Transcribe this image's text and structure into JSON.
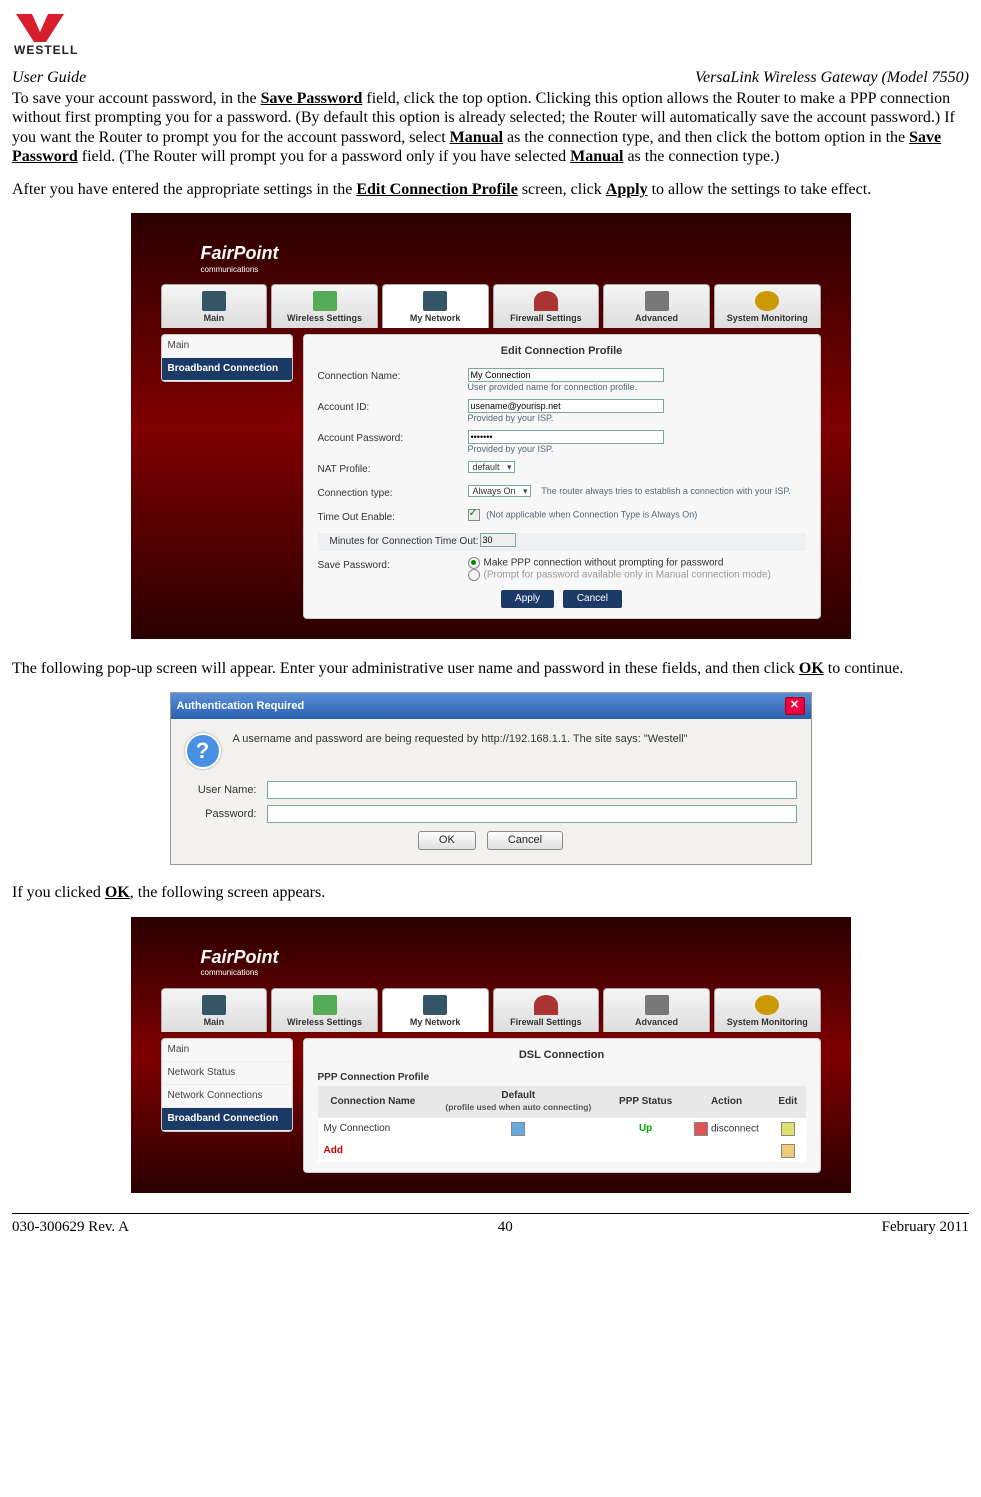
{
  "logo_text_main": "WESTELL",
  "header": {
    "left": "User Guide",
    "right": "VersaLink Wireless Gateway (Model 7550)"
  },
  "para1": {
    "t1": "To save your account password, in the ",
    "b1": "Save Password",
    "t2": " field, click the top option. Clicking this option allows the Router to make a PPP connection without first prompting you for a password. (By default this option is already selected; the Router will automatically save the account password.) If you want the Router to prompt you for the account password, select ",
    "b2": "Manual",
    "t3": " as the connection type, and then click the bottom option in the ",
    "b3": "Save Password",
    "t4": " field. (The Router will prompt you for a password only if you have selected ",
    "b4": "Manual",
    "t5": " as the connection type.)"
  },
  "para2": {
    "t1": "After you have entered the appropriate settings in the ",
    "b1": "Edit Connection Profile",
    "t2": " screen, click ",
    "b2": "Apply",
    "t3": " to allow the settings to take effect."
  },
  "router": {
    "logo": "FairPoint",
    "logo_sub": "communications",
    "tabs": [
      "Main",
      "Wireless Settings",
      "My Network",
      "Firewall Settings",
      "Advanced",
      "System Monitoring"
    ],
    "active_tab_index": 2,
    "sidebar1": [
      "Main",
      "Broadband Connection"
    ],
    "sidebar1_sel": 1,
    "panel1_title": "Edit Connection Profile",
    "form": {
      "conn_name_label": "Connection Name:",
      "conn_name_value": "My Connection",
      "conn_name_hint": "User provided name for connection profile.",
      "acct_id_label": "Account ID:",
      "acct_id_value": "usename@yourisp.net",
      "acct_id_hint": "Provided by your ISP.",
      "acct_pw_label": "Account Password:",
      "acct_pw_value": "•••••••",
      "acct_pw_hint": "Provided by your ISP.",
      "nat_label": "NAT Profile:",
      "nat_value": "default",
      "ctype_label": "Connection type:",
      "ctype_value": "Always On",
      "ctype_hint": "The router always tries to establish a connection with your ISP.",
      "timeout_label": "Time Out Enable:",
      "timeout_hint": "(Not applicable when Connection Type is Always On)",
      "minutes_label": "Minutes for Connection Time Out:",
      "minutes_value": "30",
      "savepw_label": "Save Password:",
      "savepw_opt1": "Make PPP connection without prompting for password",
      "savepw_opt2": "(Prompt for password available only in Manual connection mode)",
      "apply": "Apply",
      "cancel": "Cancel"
    }
  },
  "para3": {
    "t1": "The following pop-up screen will appear. Enter your administrative user name and password in these fields, and then click ",
    "b1": "OK",
    "t2": " to continue."
  },
  "auth": {
    "title": "Authentication Required",
    "msg": "A username and password are being requested by http://192.168.1.1. The site says: \"Westell\"",
    "user_label": "User Name:",
    "pw_label": "Password:",
    "ok": "OK",
    "cancel": "Cancel"
  },
  "para4": {
    "t1": "If you clicked ",
    "b1": "OK",
    "t2": ", the following screen appears."
  },
  "router2": {
    "sidebar": [
      "Main",
      "Network Status",
      "Network Connections",
      "Broadband Connection"
    ],
    "sidebar_sel": 3,
    "title": "DSL Connection",
    "subtitle": "PPP Connection Profile",
    "cols": [
      "Connection Name",
      "Default",
      "PPP Status",
      "Action",
      "Edit"
    ],
    "col_default_sub": "(profile used when auto connecting)",
    "row_name": "My Connection",
    "row_status": "Up",
    "row_action": "disconnect",
    "add": "Add"
  },
  "footer": {
    "left": "030-300629 Rev. A",
    "center": "40",
    "right": "February 2011"
  }
}
